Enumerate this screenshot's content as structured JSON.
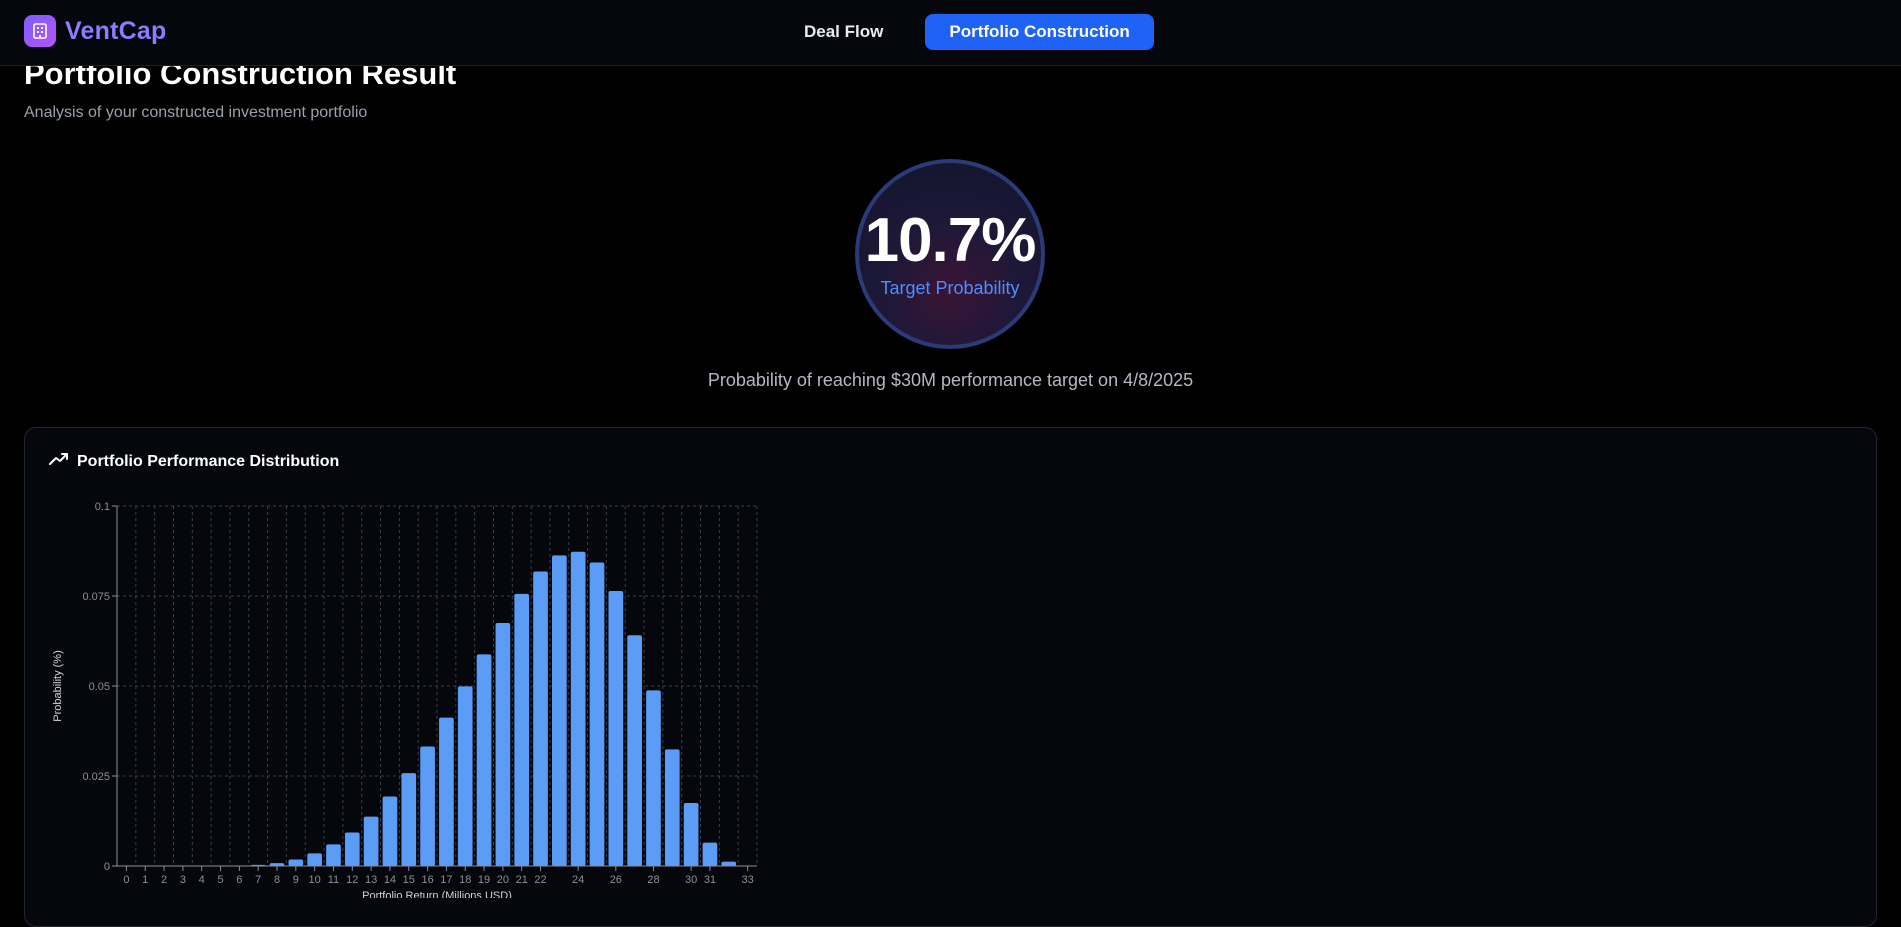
{
  "app": {
    "name": "VentCap"
  },
  "nav": {
    "items": [
      {
        "label": "Deal Flow",
        "active": false
      },
      {
        "label": "Portfolio Construction",
        "active": true
      }
    ]
  },
  "page": {
    "title": "Portfolio Construction Result",
    "subtitle": "Analysis of your constructed investment portfolio"
  },
  "result": {
    "probability": "10.7%",
    "probability_label": "Target Probability",
    "description": "Probability of reaching $30M performance target on 4/8/2025"
  },
  "distribution_card": {
    "title": "Portfolio Performance Distribution"
  },
  "colors": {
    "accent": "#1e63f5",
    "bar": "#5b9cf6",
    "brand": "#8a7dff"
  },
  "chart_data": {
    "type": "bar",
    "title": "",
    "xlabel": "Portfolio Return (Millions USD)",
    "ylabel": "Probability (%)",
    "ylim": [
      0,
      0.1
    ],
    "y_ticks": [
      "0",
      "0.025",
      "0.05",
      "0.075",
      "0.1"
    ],
    "grid": true,
    "categories": [
      0,
      1,
      2,
      3,
      4,
      5,
      6,
      7,
      8,
      9,
      10,
      11,
      12,
      13,
      14,
      15,
      16,
      17,
      18,
      19,
      20,
      21,
      22,
      23,
      24,
      25,
      26,
      27,
      28,
      29,
      30,
      31,
      32,
      33
    ],
    "x_tick_labels": [
      "0",
      "1",
      "2",
      "3",
      "4",
      "5",
      "6",
      "7",
      "8",
      "9",
      "10",
      "11",
      "12",
      "13",
      "14",
      "15",
      "16",
      "17",
      "18",
      "19",
      "20",
      "21",
      "22",
      "24",
      "26",
      "28",
      "30",
      "31",
      "33"
    ],
    "values": [
      0,
      0,
      0,
      0,
      0,
      0,
      0,
      0.0003,
      0.0008,
      0.0018,
      0.0035,
      0.006,
      0.0093,
      0.0137,
      0.0193,
      0.0258,
      0.0332,
      0.0412,
      0.0499,
      0.0588,
      0.0675,
      0.0756,
      0.0818,
      0.0863,
      0.0873,
      0.0843,
      0.0764,
      0.0641,
      0.0488,
      0.0324,
      0.0175,
      0.0065,
      0.0012,
      0
    ]
  }
}
